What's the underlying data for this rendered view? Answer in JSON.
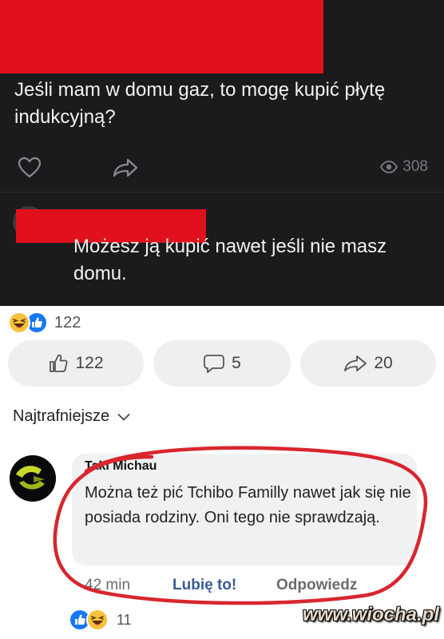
{
  "post": {
    "text": "Jeśli mam w domu gaz, to mogę kupić płytę indukcyjną?",
    "views": "308"
  },
  "reply": {
    "text": "Możesz ją kupić nawet jeśli nie masz domu."
  },
  "reactions": {
    "count": "122"
  },
  "actions": {
    "like_count": "122",
    "comment_count": "5",
    "share_count": "20"
  },
  "sort": {
    "label": "Najtrafniejsze"
  },
  "comment": {
    "author": "Taki Michau",
    "text": "Można też pić Tchibo Familly nawet jak się nie posiada rodziny. Oni tego nie sprawdzają.",
    "time": "42 min",
    "like_label": "Lubię to!",
    "reply_label": "Odpowiedz",
    "reaction_count": "11"
  },
  "watermark": "www.wiocha.pl",
  "colors": {
    "dark_bg": "#1b1b1d",
    "redaction": "#e0111d",
    "link": "#3b5b93",
    "scribble": "#d8262e"
  },
  "icons": [
    "heart-icon",
    "share-arrow-icon",
    "eye-icon",
    "haha-reaction-icon",
    "like-reaction-icon",
    "thumbs-up-icon",
    "comment-bubble-icon",
    "share-icon",
    "chevron-down-icon"
  ]
}
